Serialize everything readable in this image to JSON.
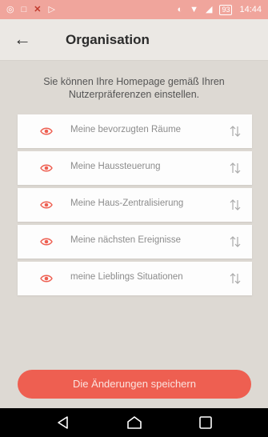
{
  "status_bar": {
    "left_icons": [
      "whatsapp-icon",
      "notification-icon",
      "close-icon",
      "play-icon"
    ],
    "right_icons": [
      "sync-icon",
      "wifi-icon",
      "signal-icon"
    ],
    "battery": "93",
    "time": "14:44"
  },
  "header": {
    "back_icon": "back-arrow-icon",
    "title": "Organisation"
  },
  "intro": {
    "text": "Sie können Ihre Homepage gemäß Ihren Nutzerpräferenzen einstellen."
  },
  "preferences": {
    "items": [
      {
        "label": "Meine bevorzugten Räume"
      },
      {
        "label": "Meine Haussteuerung"
      },
      {
        "label": "Meine Haus-Zentralisierung"
      },
      {
        "label": "Meine nächsten Ereignisse"
      },
      {
        "label": "meine Lieblings Situationen"
      }
    ]
  },
  "actions": {
    "save_label": "Die Änderungen speichern"
  },
  "colors": {
    "accent": "#ee5f51",
    "status_bar": "#f0a59c",
    "background": "#ddd9d3"
  }
}
